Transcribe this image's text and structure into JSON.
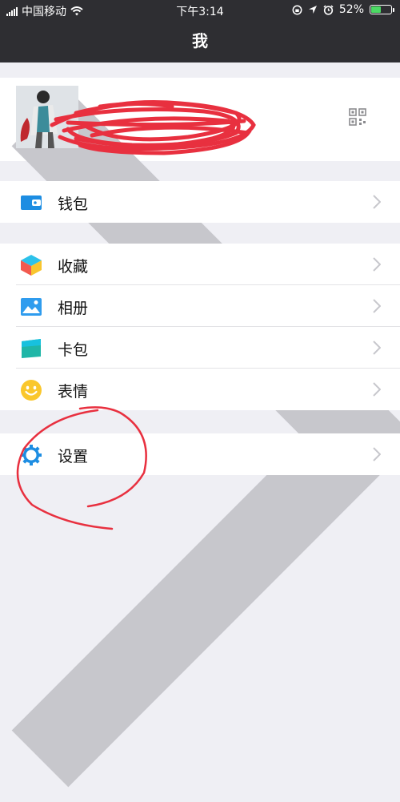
{
  "status": {
    "carrier": "中国移动",
    "time": "下午3:14",
    "battery": "52%",
    "battery_level": 0.52
  },
  "nav": {
    "title": "我"
  },
  "menu": {
    "wallet": "钱包",
    "favorites": "收藏",
    "album": "相册",
    "cards": "卡包",
    "stickers": "表情",
    "settings": "设置"
  },
  "colors": {
    "bar": "#2e2e32",
    "bg": "#efeff4",
    "accent": "#1aad19",
    "blue": "#1d8de2",
    "scribble": "#e8303f"
  }
}
